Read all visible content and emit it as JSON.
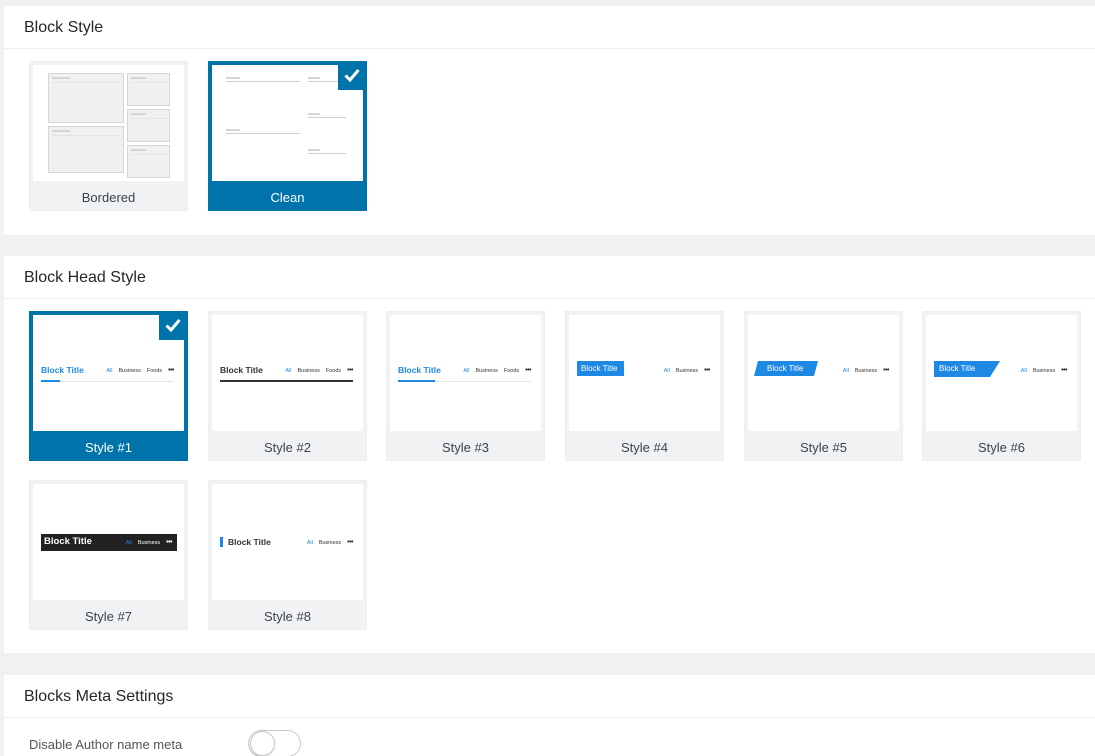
{
  "block_style": {
    "title": "Block Style",
    "options": [
      {
        "label": "Bordered",
        "selected": false
      },
      {
        "label": "Clean",
        "selected": true
      }
    ]
  },
  "head_style": {
    "title": "Block Head Style",
    "preview_text": {
      "block_title": "Block Title",
      "tab_all": "All",
      "tab_business": "Business",
      "tab_foods": "Foods",
      "more": "•••"
    },
    "options": [
      {
        "label": "Style #1",
        "selected": true
      },
      {
        "label": "Style #2",
        "selected": false
      },
      {
        "label": "Style #3",
        "selected": false
      },
      {
        "label": "Style #4",
        "selected": false
      },
      {
        "label": "Style #5",
        "selected": false
      },
      {
        "label": "Style #6",
        "selected": false
      },
      {
        "label": "Style #7",
        "selected": false
      },
      {
        "label": "Style #8",
        "selected": false
      }
    ]
  },
  "meta_settings": {
    "title": "Blocks Meta Settings",
    "disable_author_label": "Disable Author name meta",
    "disable_author_enabled": false
  },
  "colors": {
    "accent": "#0073aa",
    "preview_blue": "#1e88e5",
    "dark_bar": "#222222"
  }
}
